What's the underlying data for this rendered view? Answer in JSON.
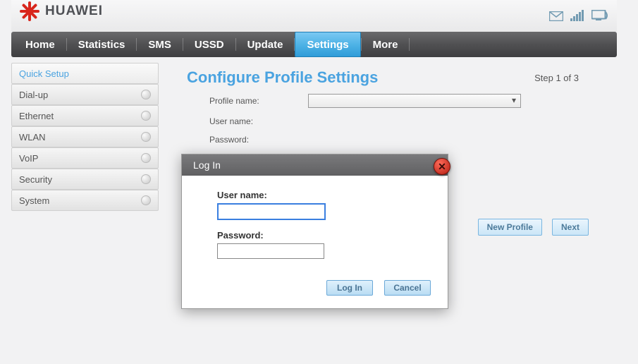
{
  "brand": {
    "name": "HUAWEI"
  },
  "header_icons": {
    "mail": "mail-icon",
    "signal": "signal-icon",
    "monitor": "monitor-icon"
  },
  "nav": {
    "items": [
      {
        "label": "Home",
        "active": false
      },
      {
        "label": "Statistics",
        "active": false
      },
      {
        "label": "SMS",
        "active": false
      },
      {
        "label": "USSD",
        "active": false
      },
      {
        "label": "Update",
        "active": false
      },
      {
        "label": "Settings",
        "active": true
      },
      {
        "label": "More",
        "active": false
      }
    ]
  },
  "sidebar": {
    "items": [
      {
        "label": "Quick Setup",
        "active": true
      },
      {
        "label": "Dial-up",
        "active": false
      },
      {
        "label": "Ethernet",
        "active": false
      },
      {
        "label": "WLAN",
        "active": false
      },
      {
        "label": "VoIP",
        "active": false
      },
      {
        "label": "Security",
        "active": false
      },
      {
        "label": "System",
        "active": false
      }
    ]
  },
  "main": {
    "title": "Configure Profile Settings",
    "step": "Step 1 of 3",
    "fields": {
      "profile_name_label": "Profile name:",
      "profile_name_value": "",
      "user_name_label": "User name:",
      "password_label": "Password:"
    },
    "buttons": {
      "new_profile": "New Profile",
      "next": "Next"
    }
  },
  "modal": {
    "title": "Log In",
    "username_label": "User name:",
    "username_value": "",
    "password_label": "Password:",
    "password_value": "",
    "login": "Log In",
    "cancel": "Cancel",
    "close": "✕"
  }
}
